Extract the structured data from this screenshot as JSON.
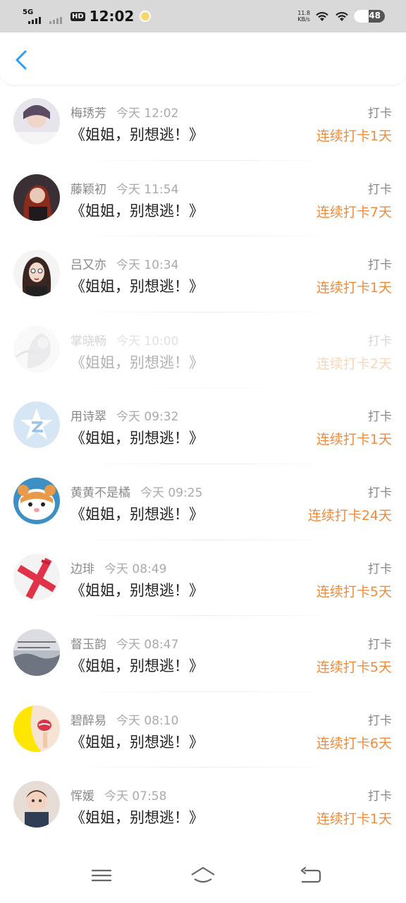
{
  "status_bar": {
    "network": "5G",
    "hd": "HD",
    "time": "12:02",
    "speed_value": "11.8",
    "speed_unit": "KB/s",
    "battery": "48"
  },
  "header": {
    "back_icon": "chevron-left-icon"
  },
  "items": [
    {
      "name": "梅琇芳",
      "time": "今天 12:02",
      "title": "《姐姐，别想逃！》",
      "action": "打卡",
      "streak": "连续打卡1天"
    },
    {
      "name": "藤颖初",
      "time": "今天 11:54",
      "title": "《姐姐，别想逃！》",
      "action": "打卡",
      "streak": "连续打卡7天"
    },
    {
      "name": "吕又亦",
      "time": "今天 10:34",
      "title": "《姐姐，别想逃！》",
      "action": "打卡",
      "streak": "连续打卡1天"
    },
    {
      "name": "掌晓畅",
      "time": "今天 10:00",
      "title": "《姐姐，别想逃！》",
      "action": "打卡",
      "streak": "连续打卡2天"
    },
    {
      "name": "用诗翠",
      "time": "今天 09:32",
      "title": "《姐姐，别想逃！》",
      "action": "打卡",
      "streak": "连续打卡1天"
    },
    {
      "name": "黄黄不是橘",
      "time": "今天 09:25",
      "title": "《姐姐，别想逃！》",
      "action": "打卡",
      "streak": "连续打卡24天"
    },
    {
      "name": "边琲",
      "time": "今天 08:49",
      "title": "《姐姐，别想逃！》",
      "action": "打卡",
      "streak": "连续打卡5天"
    },
    {
      "name": "督玉韵",
      "time": "今天 08:47",
      "title": "《姐姐，别想逃！》",
      "action": "打卡",
      "streak": "连续打卡5天"
    },
    {
      "name": "碧醉易",
      "time": "今天 08:10",
      "title": "《姐姐，别想逃！》",
      "action": "打卡",
      "streak": "连续打卡6天"
    },
    {
      "name": "恽媛",
      "time": "今天 07:58",
      "title": "《姐姐，别想逃！》",
      "action": "打卡",
      "streak": "连续打卡1天"
    }
  ],
  "colors": {
    "accent": "#2a9df4",
    "streak": "#f08b3a",
    "status_bg": "#d9d9d9"
  },
  "nav": {
    "menu_icon": "menu-icon",
    "home_icon": "home-icon",
    "back_icon": "back-icon"
  }
}
